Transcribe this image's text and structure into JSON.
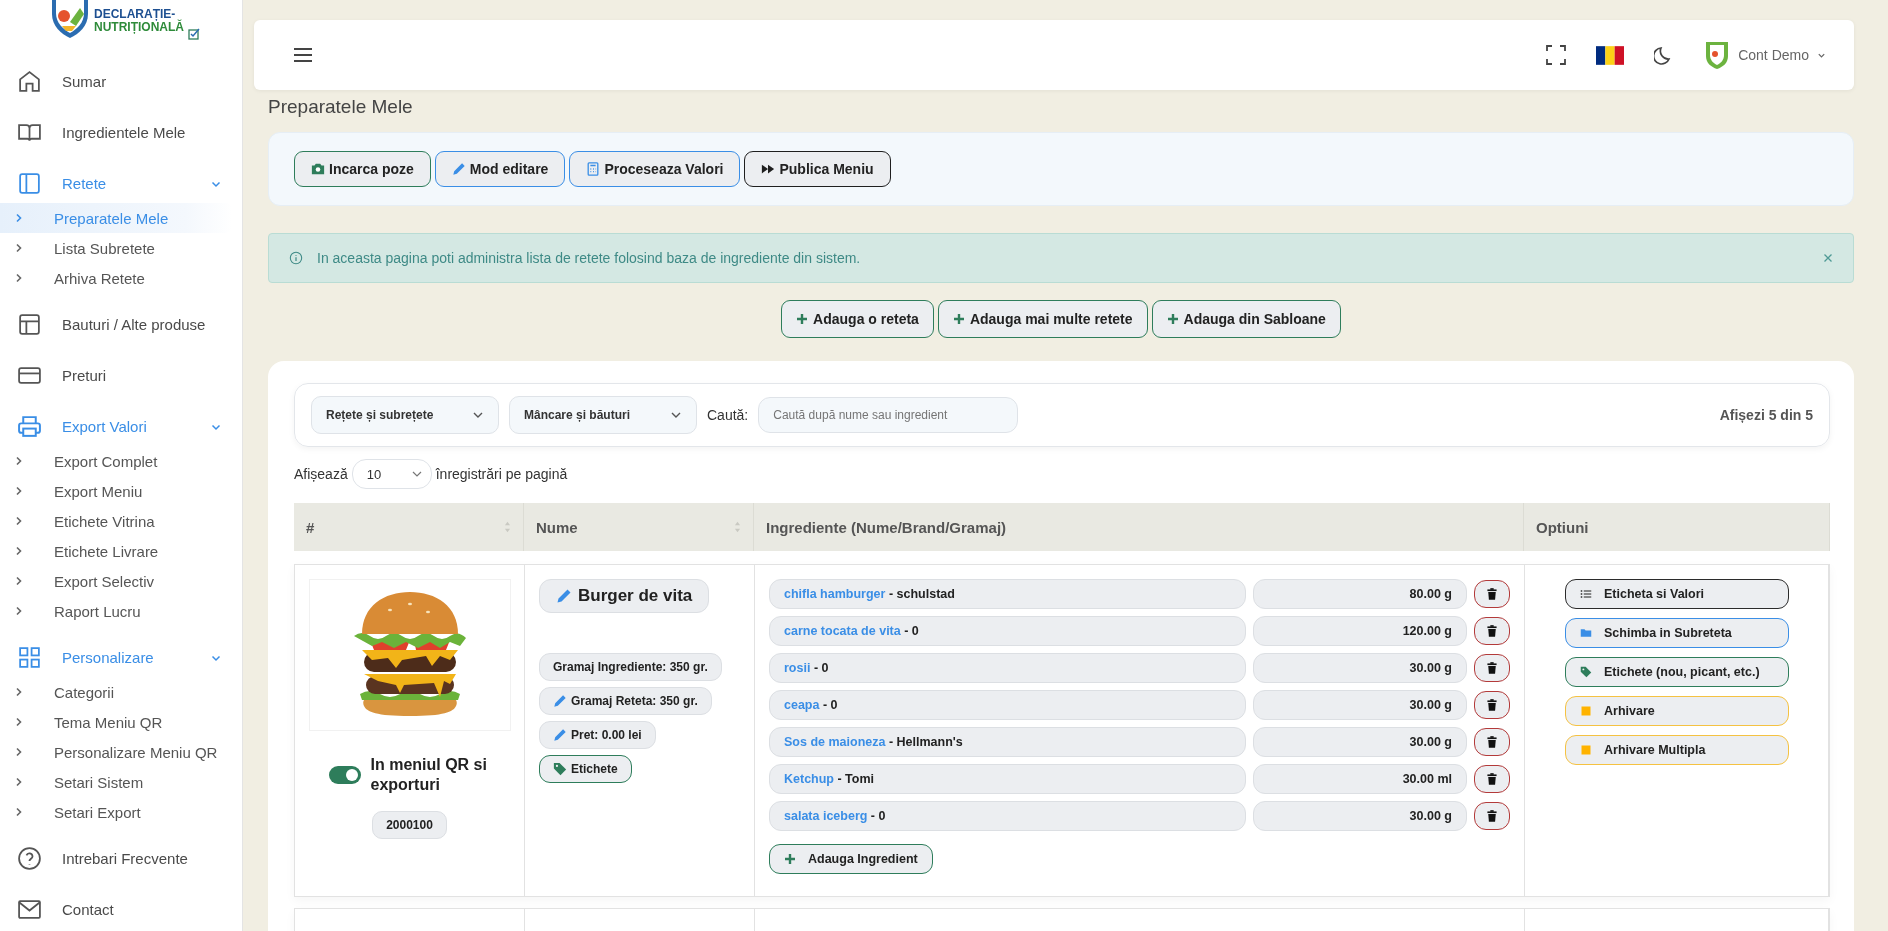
{
  "sidebar": {
    "logo": {
      "line1": "DECLARAȚIE-",
      "line2": "NUTRIȚIONALĂ"
    },
    "items": [
      {
        "label": "Sumar",
        "kind": "link"
      },
      {
        "label": "Ingredientele Mele",
        "kind": "link"
      },
      {
        "label": "Retete",
        "kind": "group",
        "expanded": true,
        "children": [
          {
            "label": "Preparatele Mele",
            "selected": true
          },
          {
            "label": "Lista Subretete",
            "selected": false
          },
          {
            "label": "Arhiva Retete",
            "selected": false
          }
        ]
      },
      {
        "label": "Bauturi / Alte produse",
        "kind": "link"
      },
      {
        "label": "Preturi",
        "kind": "link"
      },
      {
        "label": "Export Valori",
        "kind": "group",
        "expanded": true,
        "children": [
          {
            "label": "Export Complet",
            "selected": false
          },
          {
            "label": "Export Meniu",
            "selected": false
          },
          {
            "label": "Etichete Vitrina",
            "selected": false
          },
          {
            "label": "Etichete Livrare",
            "selected": false
          },
          {
            "label": "Export Selectiv",
            "selected": false
          },
          {
            "label": "Raport Lucru",
            "selected": false
          }
        ]
      },
      {
        "label": "Personalizare",
        "kind": "group",
        "expanded": true,
        "children": [
          {
            "label": "Categorii",
            "selected": false
          },
          {
            "label": "Tema Meniu QR",
            "selected": false
          },
          {
            "label": "Personalizare Meniu QR",
            "selected": false
          },
          {
            "label": "Setari Sistem",
            "selected": false
          },
          {
            "label": "Setari Export",
            "selected": false
          }
        ]
      },
      {
        "label": "Intrebari Frecvente",
        "kind": "link"
      },
      {
        "label": "Contact",
        "kind": "link"
      }
    ]
  },
  "header": {
    "user": "Cont Demo"
  },
  "page": {
    "title": "Preparatele Mele"
  },
  "toolbar": [
    {
      "label": "Incarca poze",
      "color": "#2e7d5b"
    },
    {
      "label": "Mod editare",
      "color": "#3a8ee6"
    },
    {
      "label": "Proceseaza Valori",
      "color": "#3a8ee6"
    },
    {
      "label": "Publica Meniu",
      "color": "#1f1f1f"
    }
  ],
  "alert": {
    "text": "In aceasta pagina poti administra lista de retete folosind baza de ingrediente din sistem.",
    "dismissible": true
  },
  "add_buttons": [
    "Adauga o reteta",
    "Adauga mai multe retete",
    "Adauga din Sabloane"
  ],
  "filters": {
    "type": "Rețete și subrețete",
    "category": "Mâncare și băuturi",
    "search_label": "Caută:",
    "search_placeholder": "Caută după nume sau ingredient",
    "count": "Afișezi 5 din 5"
  },
  "page_length": {
    "before": "Afișează",
    "value": "10",
    "after": "înregistrări pe pagină"
  },
  "table": {
    "columns": [
      {
        "label": "#",
        "sortable": true
      },
      {
        "label": "Nume",
        "sortable": true
      },
      {
        "label": "Ingrediente (Nume/Brand/Gramaj)",
        "sortable": false
      },
      {
        "label": "Optiuni",
        "sortable": false
      }
    ],
    "rows": [
      {
        "image": {
          "kind": "picture"
        },
        "in_menu": true,
        "menu_label": "In meniul QR si exporturi",
        "code": "2000100",
        "name": "Burger de vita",
        "info": [
          {
            "label": "Gramaj Ingrediente: 350 gr.",
            "editable": false
          },
          {
            "label": "Gramaj Reteta: 350 gr.",
            "editable": true
          },
          {
            "label": "Pret: 0.00 lei",
            "editable": true
          }
        ],
        "tags_button": "Etichete",
        "ingredients": [
          {
            "name": "chifla hamburger",
            "brand": "- schulstad",
            "quantity": "80.00 g"
          },
          {
            "name": "carne tocata de vita",
            "brand": "- 0",
            "quantity": "120.00 g"
          },
          {
            "name": "rosii",
            "brand": "- 0",
            "quantity": "30.00 g"
          },
          {
            "name": "ceapa",
            "brand": "- 0",
            "quantity": "30.00 g"
          },
          {
            "name": "Sos de maioneza",
            "brand": "- Hellmann's",
            "quantity": "30.00 g"
          },
          {
            "name": "Ketchup",
            "brand": "- Tomi",
            "quantity": "30.00 ml"
          },
          {
            "name": "salata iceberg",
            "brand": "- 0",
            "quantity": "30.00 g"
          }
        ],
        "add_ingredient": "Adauga Ingredient",
        "options": [
          {
            "label": "Eticheta si Valori",
            "color": "#2b2b2b"
          },
          {
            "label": "Schimba in Subreteta",
            "color": "#3a8ee6"
          },
          {
            "label": "Etichete (nou, picant, etc.)",
            "color": "#2e7d5b"
          },
          {
            "label": "Arhivare",
            "color": "#f5c242"
          },
          {
            "label": "Arhivare Multipla",
            "color": "#f5c242"
          }
        ]
      }
    ]
  }
}
